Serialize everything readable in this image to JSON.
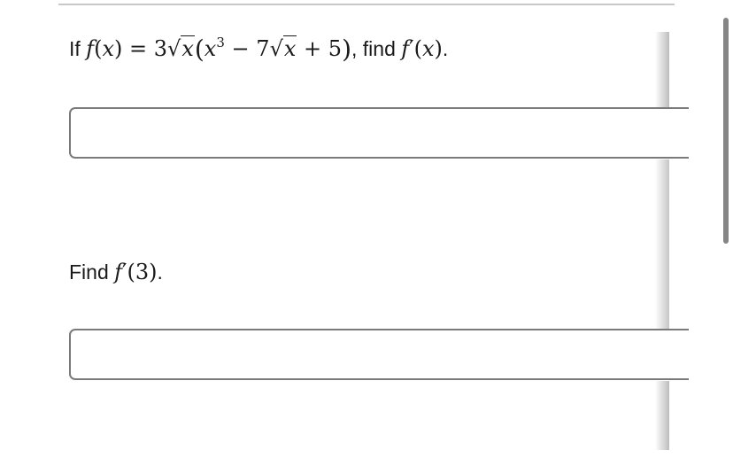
{
  "question1": {
    "prefix": "If",
    "func": "f",
    "var": "x",
    "eq": "=",
    "coef": "3",
    "exp": "3",
    "minus": "−",
    "coef2": "7",
    "plus": "+",
    "const": "5",
    "find": ", find",
    "target": "f",
    "prime": "′",
    "period": "."
  },
  "question2": {
    "prefix": "Find",
    "func": "f",
    "prime": "′",
    "arg": "3",
    "period": "."
  },
  "answer1": {
    "value": "",
    "placeholder": ""
  },
  "answer2": {
    "value": "",
    "placeholder": ""
  }
}
